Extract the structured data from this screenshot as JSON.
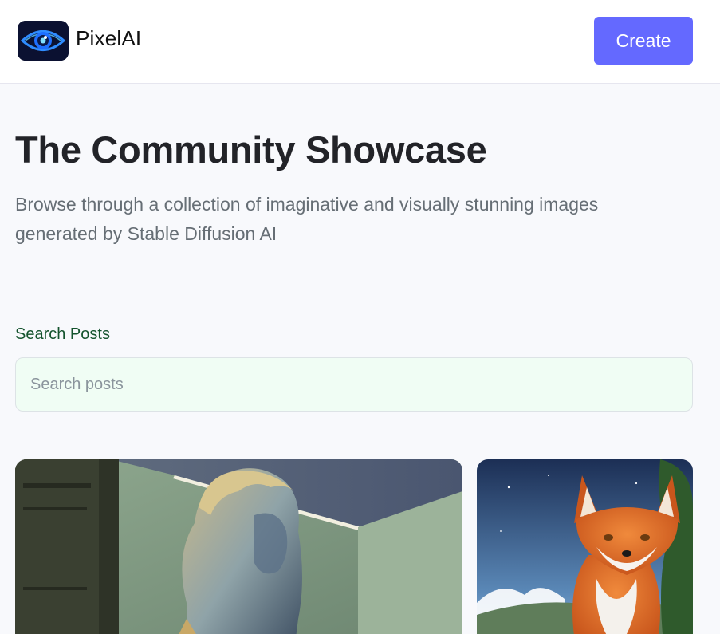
{
  "header": {
    "brand": "PixelAI",
    "create_label": "Create",
    "logo_icon": "eye-icon"
  },
  "hero": {
    "title": "The Community Showcase",
    "subtitle": "Browse through a collection of imaginative and visually stunning images generated by Stable Diffusion AI"
  },
  "search": {
    "label": "Search Posts",
    "placeholder": "Search posts",
    "value": ""
  },
  "posts": [
    {
      "subject": "marble-bust-image"
    },
    {
      "subject": "fox-image"
    }
  ],
  "colors": {
    "accent": "#6469ff",
    "search_bg": "#f0fdf4",
    "label_green": "#14532d",
    "page_bg": "#f8f9fc"
  }
}
